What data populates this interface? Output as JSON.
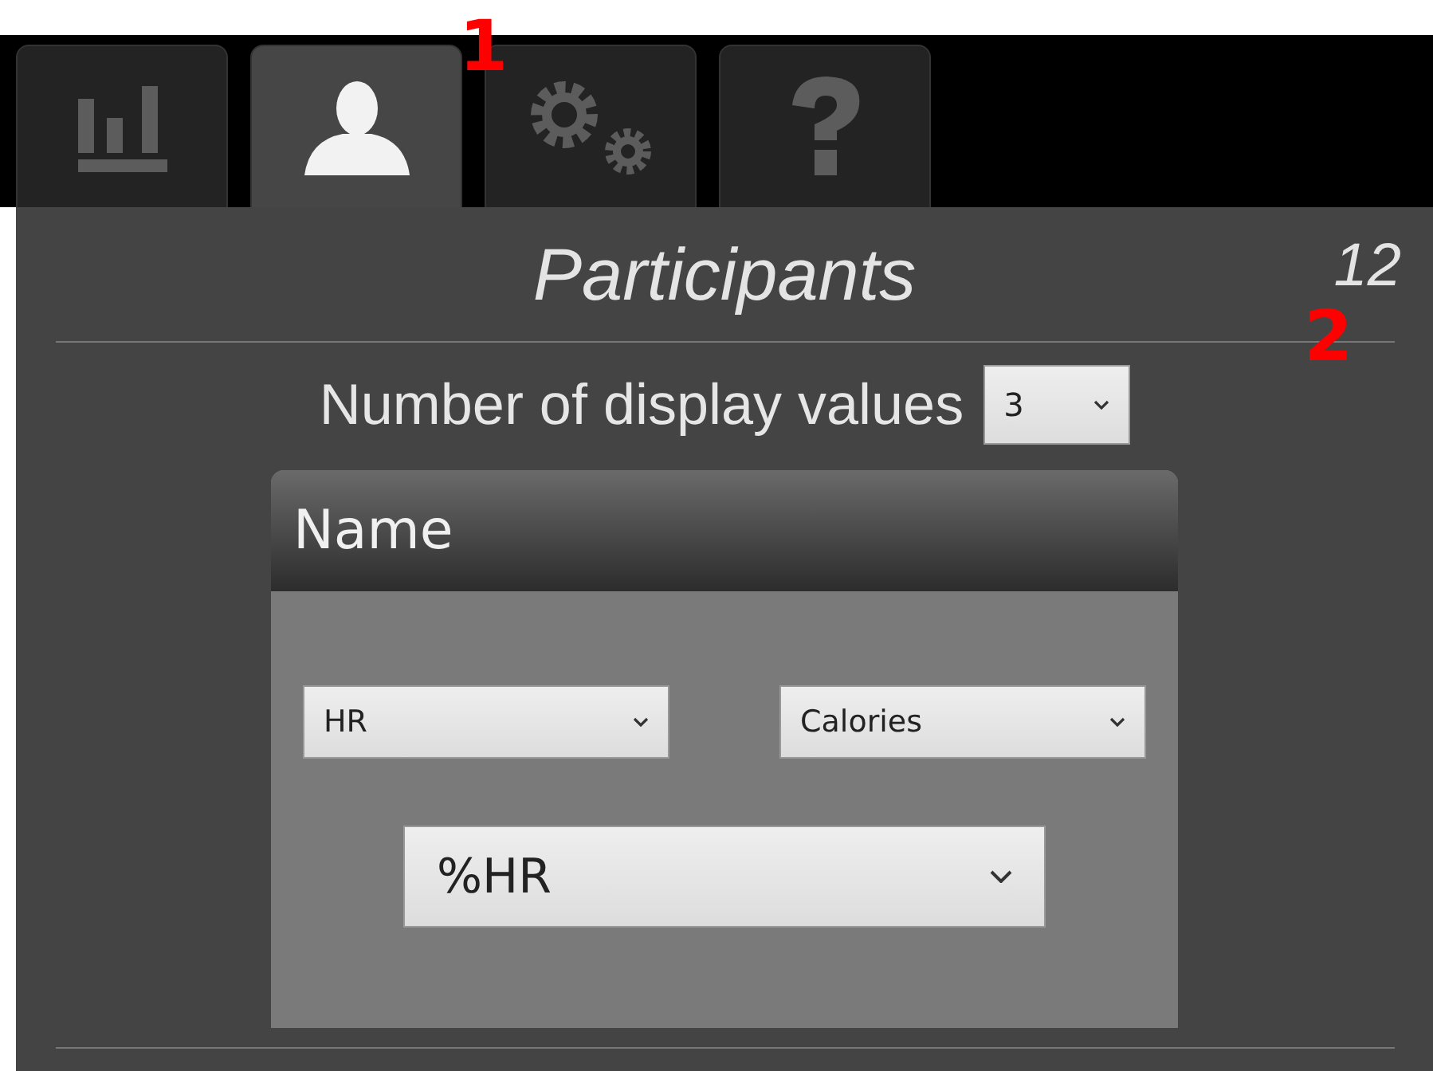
{
  "tabs": [
    {
      "kind": "chart",
      "selected": false
    },
    {
      "kind": "person",
      "selected": true
    },
    {
      "kind": "gears",
      "selected": false
    },
    {
      "kind": "help",
      "selected": false
    }
  ],
  "panel": {
    "title": "Participants",
    "count": "12",
    "display_values": {
      "label": "Number of display values",
      "value": "3"
    },
    "card": {
      "title": "Name",
      "selects": [
        {
          "value": "HR"
        },
        {
          "value": "Calories"
        }
      ],
      "main_select": {
        "value": "%HR"
      }
    }
  },
  "callouts": [
    "1",
    "2"
  ]
}
